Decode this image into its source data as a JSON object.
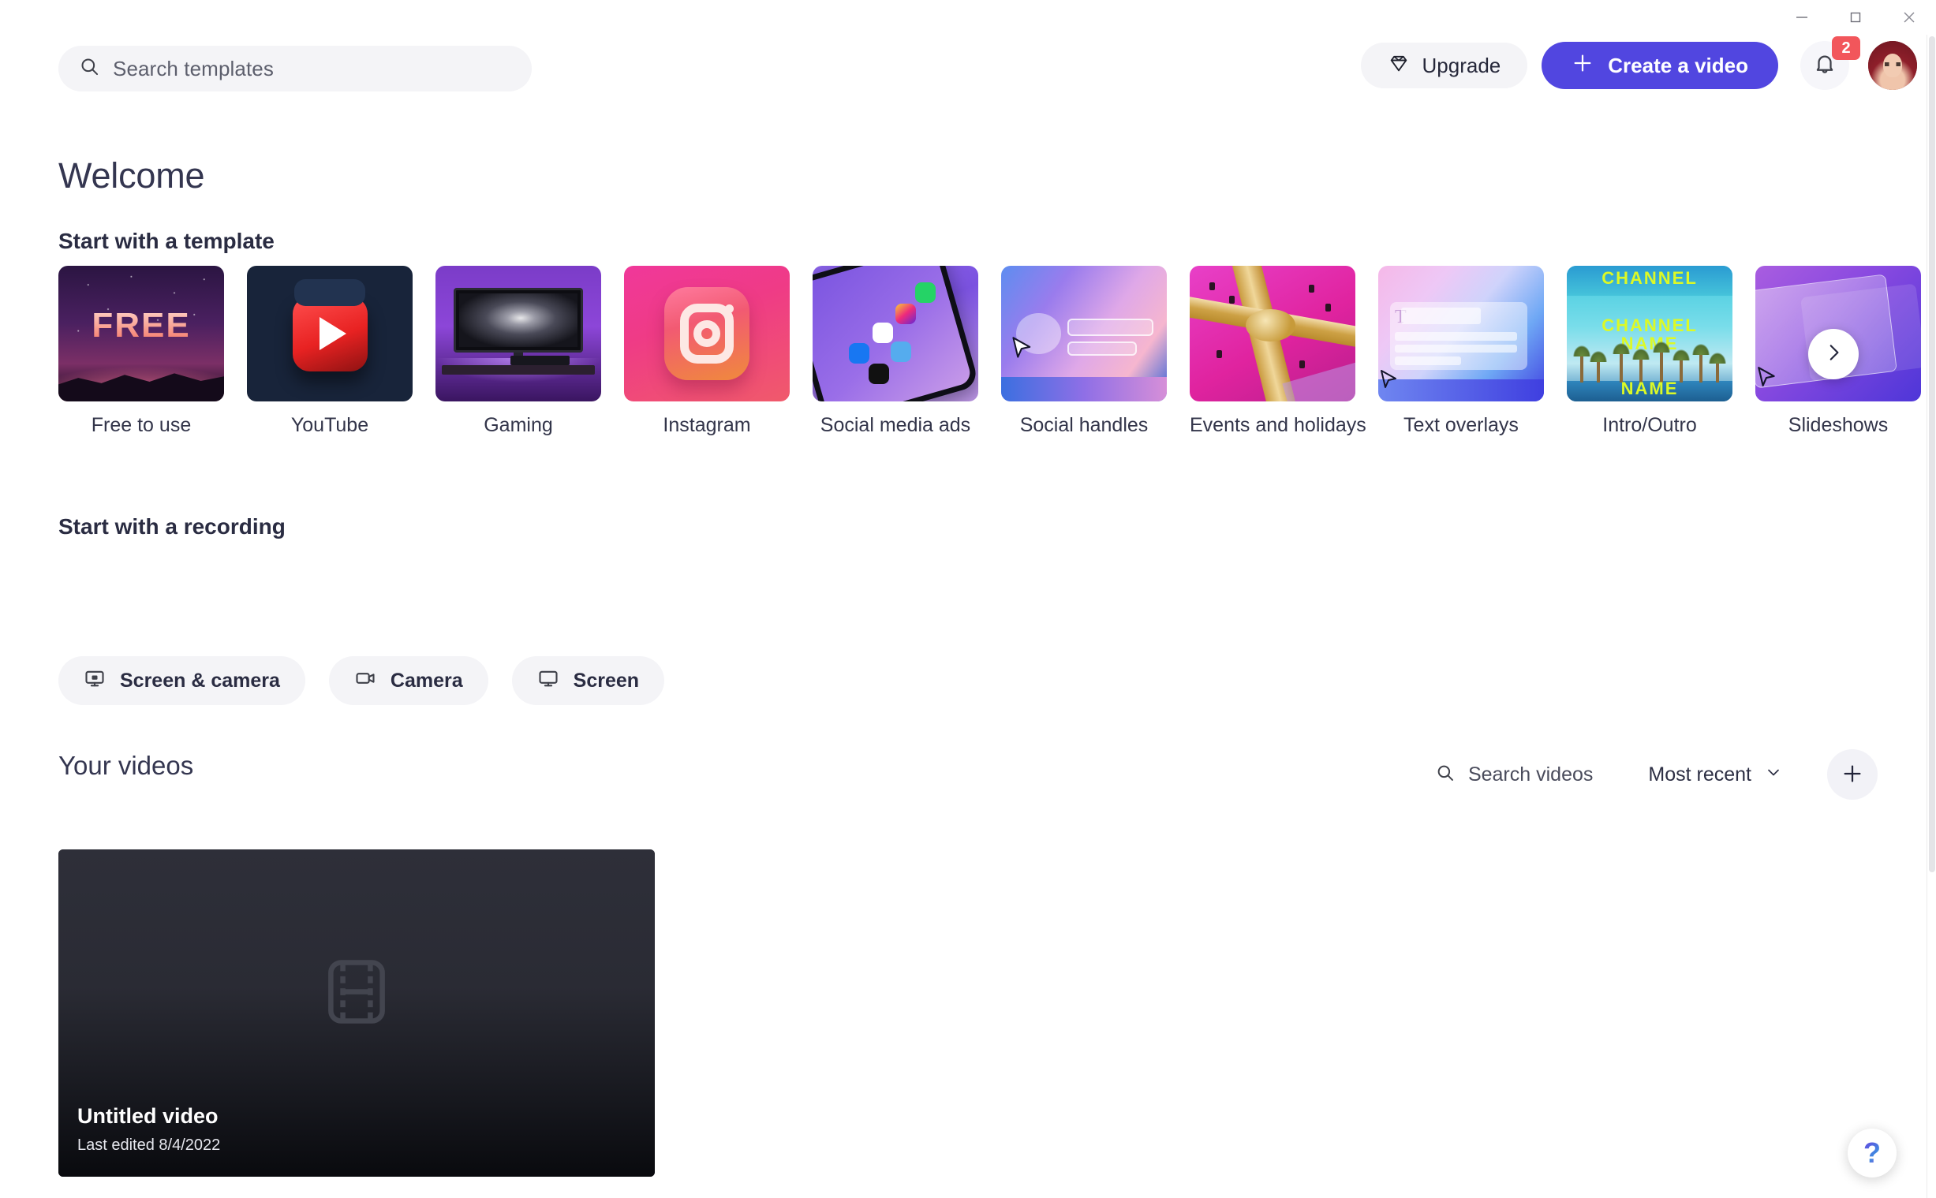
{
  "window": {
    "minimize_icon": "minimize-icon",
    "maximize_icon": "maximize-icon",
    "close_icon": "close-icon"
  },
  "header": {
    "search": {
      "icon": "search-icon",
      "placeholder": "Search templates",
      "value": ""
    },
    "upgrade_label": "Upgrade",
    "upgrade_icon": "diamond-icon",
    "create_label": "Create a video",
    "create_icon": "plus-icon",
    "create_button_color": "#5146e0",
    "notifications": {
      "icon": "bell-icon",
      "badge_count": "2",
      "badge_color": "#f2565b"
    },
    "avatar": "user-avatar"
  },
  "page": {
    "welcome_title": "Welcome",
    "templates_section_title": "Start with a template",
    "recording_section_title": "Start with a recording",
    "videos_section_title": "Your videos"
  },
  "templates": {
    "next_icon": "chevron-right-icon",
    "items": [
      {
        "label": "Free to use",
        "art": "free",
        "art_text": "FREE"
      },
      {
        "label": "YouTube",
        "art": "youtube"
      },
      {
        "label": "Gaming",
        "art": "gaming"
      },
      {
        "label": "Instagram",
        "art": "instagram"
      },
      {
        "label": "Social media ads",
        "art": "ads"
      },
      {
        "label": "Social handles",
        "art": "handles"
      },
      {
        "label": "Events and holidays",
        "art": "events"
      },
      {
        "label": "Text overlays",
        "art": "text"
      },
      {
        "label": "Intro/Outro",
        "art": "intro",
        "art_text_top": "CHANNEL",
        "art_text_mid": "CHANNEL\nNAME",
        "art_text_bottom": "NAME"
      },
      {
        "label": "Slideshows",
        "art": "slides"
      }
    ]
  },
  "recording": {
    "buttons": [
      {
        "label": "Screen & camera",
        "icon": "screen-camera-icon"
      },
      {
        "label": "Camera",
        "icon": "camera-icon"
      },
      {
        "label": "Screen",
        "icon": "monitor-icon"
      }
    ]
  },
  "videos": {
    "search": {
      "icon": "search-icon",
      "placeholder": "Search videos",
      "value": ""
    },
    "sort": {
      "selected": "Most recent",
      "icon": "chevron-down-icon"
    },
    "add_icon": "plus-icon",
    "items": [
      {
        "title": "Untitled video",
        "subtitle": "Last edited 8/4/2022",
        "thumbnail_icon": "film-strip-icon"
      }
    ]
  },
  "help": {
    "label": "?",
    "icon": "question-mark-icon"
  }
}
